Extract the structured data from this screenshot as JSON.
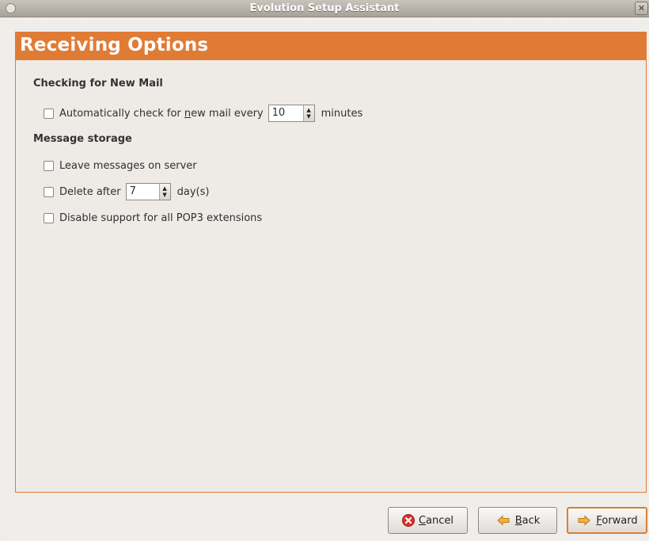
{
  "window": {
    "title": "Evolution Setup Assistant"
  },
  "page": {
    "heading": "Receiving Options"
  },
  "checking": {
    "section_title": "Checking for New Mail",
    "auto_check_prefix": "Automatically check for ",
    "auto_check_mnemonic": "n",
    "auto_check_suffix": "ew mail every",
    "interval_value": "10",
    "interval_unit": "minutes"
  },
  "storage": {
    "section_title": "Message storage",
    "leave_on_server": "Leave messages on server",
    "delete_after_label": "Delete after",
    "delete_after_value": "7",
    "delete_after_unit": "day(s)",
    "disable_pop3": "Disable support for all POP3 extensions"
  },
  "buttons": {
    "cancel_mnemonic": "C",
    "cancel_rest": "ancel",
    "back_mnemonic": "B",
    "back_rest": "ack",
    "forward_mnemonic": "F",
    "forward_rest": "orward"
  },
  "colors": {
    "accent": "#e07b35",
    "background": "#eeebe7"
  }
}
